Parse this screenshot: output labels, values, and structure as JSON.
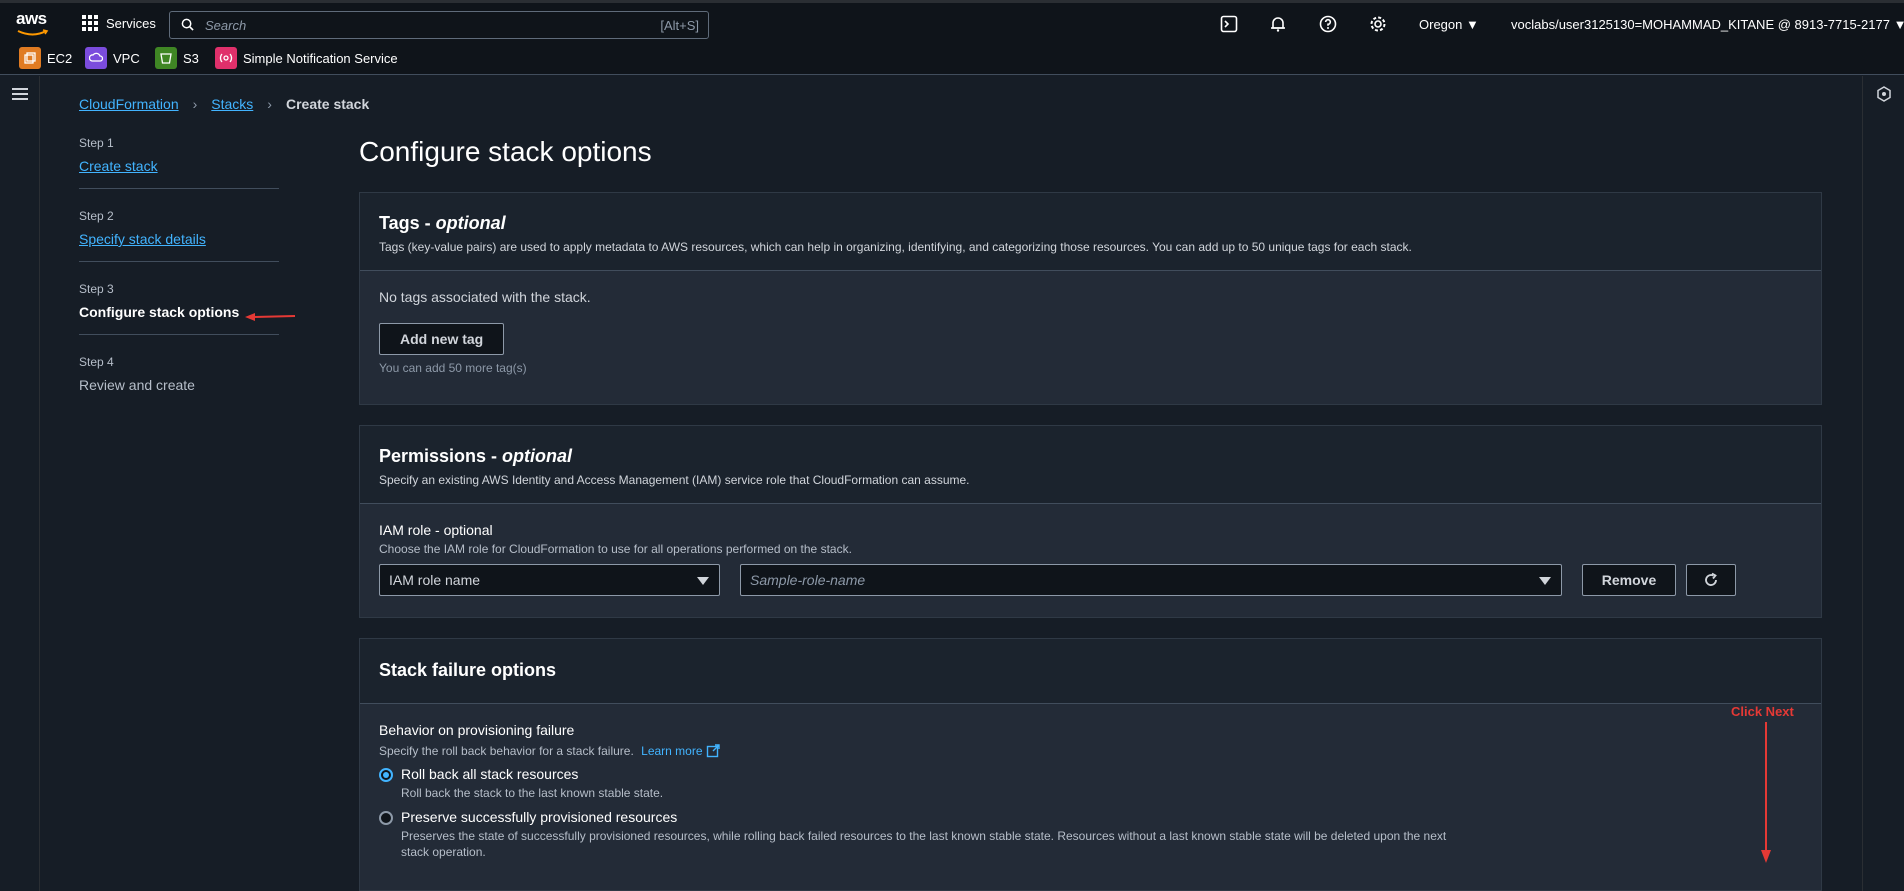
{
  "topnav": {
    "logo": "aws",
    "services_label": "Services",
    "search_placeholder": "Search",
    "search_shortcut": "[Alt+S]",
    "region": "Oregon ▼",
    "account": "voclabs/user3125130=MOHAMMAD_KITANE @ 8913-7715-2177 ▼",
    "icons": [
      "cloudshell-icon",
      "bell-icon",
      "help-icon",
      "gear-icon"
    ]
  },
  "favorites": [
    {
      "label": "EC2",
      "color": "#e07b22",
      "icon": "ec2-icon"
    },
    {
      "label": "VPC",
      "color": "#7b4cdd",
      "icon": "vpc-icon"
    },
    {
      "label": "S3",
      "color": "#3f8624",
      "icon": "s3-icon"
    },
    {
      "label": "Simple Notification Service",
      "color": "#e0306b",
      "icon": "sns-icon"
    }
  ],
  "breadcrumb": {
    "items": [
      "CloudFormation",
      "Stacks"
    ],
    "current": "Create stack",
    "separator": "›"
  },
  "steps": [
    {
      "num": "Step 1",
      "label": "Create stack"
    },
    {
      "num": "Step 2",
      "label": "Specify stack details"
    },
    {
      "num": "Step 3",
      "label": "Configure stack options"
    },
    {
      "num": "Step 4",
      "label": "Review and create"
    }
  ],
  "page_title": "Configure stack options",
  "tags": {
    "title": "Tags - ",
    "title_opt": "optional",
    "description": "Tags (key-value pairs) are used to apply metadata to AWS resources, which can help in organizing, identifying, and categorizing those resources. You can add up to 50 unique tags for each stack.",
    "empty": "No tags associated with the stack.",
    "add_button": "Add new tag",
    "hint": "You can add 50 more tag(s)"
  },
  "permissions": {
    "title": "Permissions - ",
    "title_opt": "optional",
    "description": "Specify an existing AWS Identity and Access Management (IAM) service role that CloudFormation can assume.",
    "role_label": "IAM role - optional",
    "role_desc": "Choose the IAM role for CloudFormation to use for all operations performed on the stack.",
    "role_type": "IAM role name",
    "role_placeholder": "Sample-role-name",
    "remove_button": "Remove"
  },
  "failure": {
    "title": "Stack failure options",
    "behavior_label": "Behavior on provisioning failure",
    "behavior_desc": "Specify the roll back behavior for a stack failure.",
    "learn_more": "Learn more",
    "options": [
      {
        "label": "Roll back all stack resources",
        "desc": "Roll back the stack to the last known stable state.",
        "selected": true
      },
      {
        "label": "Preserve successfully provisioned resources",
        "desc": "Preserves the state of successfully provisioned resources, while rolling back failed resources to the last known stable state. Resources without a last known stable state will be deleted upon the next stack operation.",
        "selected": false
      }
    ]
  },
  "annotation": {
    "text": "Click Next",
    "color": "#e53935"
  }
}
